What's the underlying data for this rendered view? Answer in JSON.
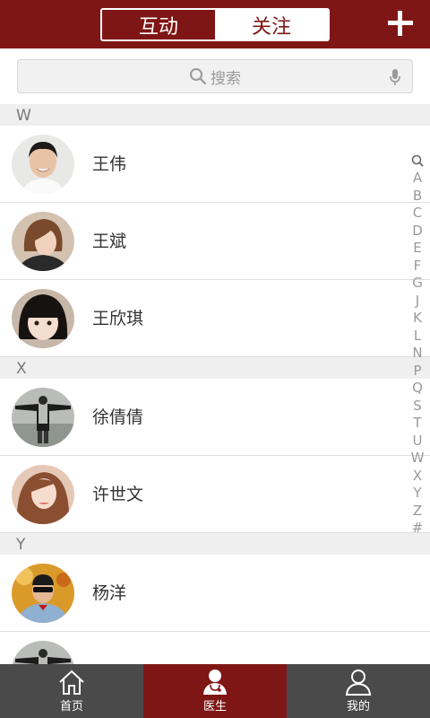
{
  "header": {
    "tabs": [
      {
        "label": "互动",
        "active": true
      },
      {
        "label": "关注",
        "active": false
      }
    ],
    "add_icon": "plus-icon",
    "accent_color": "#7f1616"
  },
  "search": {
    "placeholder": "搜索",
    "icon": "search-icon",
    "voice_icon": "microphone-icon"
  },
  "sections": [
    {
      "letter": "W",
      "contacts": [
        {
          "name": "王伟",
          "avatar": "man-short-hair"
        },
        {
          "name": "王斌",
          "avatar": "woman-bob"
        },
        {
          "name": "王欣琪",
          "avatar": "child-bangs"
        }
      ]
    },
    {
      "letter": "X",
      "contacts": [
        {
          "name": "徐倩倩",
          "avatar": "person-arms-out"
        },
        {
          "name": "许世文",
          "avatar": "woman-long-hair"
        }
      ]
    },
    {
      "letter": "Y",
      "contacts": [
        {
          "name": "杨洋",
          "avatar": "man-sunglasses"
        },
        {
          "name": "",
          "avatar": "person-arms-out"
        }
      ]
    }
  ],
  "alpha_index": [
    "A",
    "B",
    "C",
    "D",
    "E",
    "F",
    "G",
    "J",
    "K",
    "L",
    "N",
    "P",
    "Q",
    "S",
    "T",
    "U",
    "W",
    "X",
    "Y",
    "Z",
    "#"
  ],
  "bottom_nav": [
    {
      "label": "首页",
      "icon": "home-icon",
      "active": false
    },
    {
      "label": "医生",
      "icon": "doctor-icon",
      "active": true
    },
    {
      "label": "我的",
      "icon": "user-icon",
      "active": false
    }
  ]
}
